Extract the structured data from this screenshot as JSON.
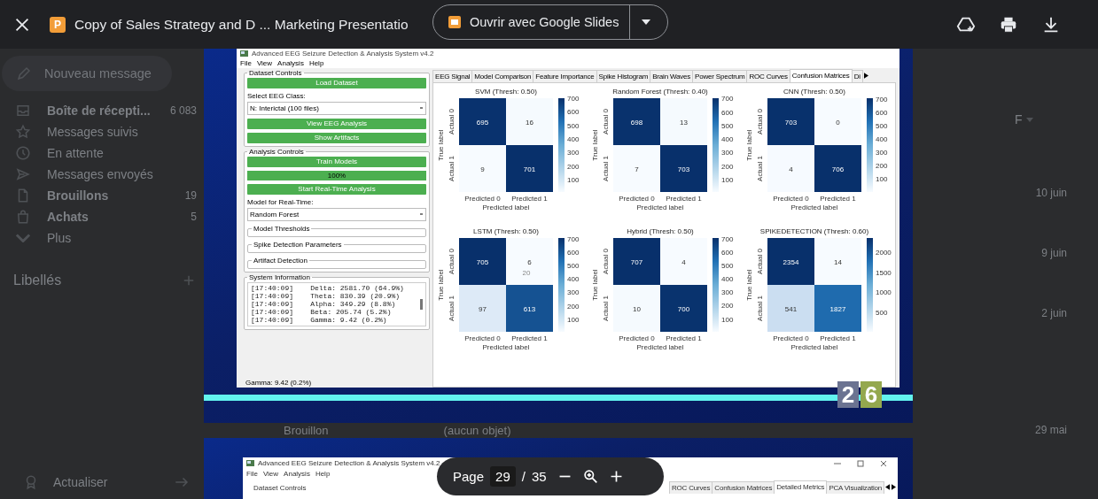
{
  "topbar": {
    "file_badge": "P",
    "title": "Copy of Sales Strategy and D ... Marketing Presentatio",
    "open_button": "Ouvrir avec Google Slides"
  },
  "gmail": {
    "compose": "Nouveau message",
    "nav": [
      {
        "label": "Boîte de récepti...",
        "count": "6 083",
        "unread": true
      },
      {
        "label": "Messages suivis",
        "unread": false
      },
      {
        "label": "En attente",
        "unread": false
      },
      {
        "label": "Messages envoyés",
        "unread": false
      },
      {
        "label": "Brouillons",
        "count": "19",
        "unread": true
      },
      {
        "label": "Achats",
        "count": "5",
        "unread": true
      },
      {
        "label": "Plus",
        "unread": false
      }
    ],
    "labels_heading": "Libellés",
    "upgrade": "Actualiser",
    "list_filter": "F",
    "rows": [
      {
        "kind": "mail",
        "date": "10 juin"
      },
      {
        "kind": "mail",
        "date": "9 juin"
      },
      {
        "kind": "mail",
        "date": "2 juin"
      },
      {
        "kind": "draft",
        "sender": "Brouillon",
        "subject": "(aucun objet)",
        "date": "29 mai"
      }
    ]
  },
  "slides": [
    {
      "window_title": "Advanced EEG Seizure Detection & Analysis System v4.2",
      "menu": [
        "File",
        "View",
        "Analysis",
        "Help"
      ],
      "sections": [
        {
          "title": "Dataset Controls",
          "items": [
            {
              "kind": "button",
              "label": "Load Dataset"
            },
            {
              "kind": "label",
              "label": "Select EEG Class:"
            },
            {
              "kind": "select",
              "value": "N: Interictal (100 files)"
            },
            {
              "kind": "button",
              "label": "View EEG Analysis"
            },
            {
              "kind": "button",
              "label": "Show Artifacts"
            }
          ]
        },
        {
          "title": "Analysis Controls",
          "items": [
            {
              "kind": "button",
              "label": "Train Models"
            },
            {
              "kind": "progress",
              "label": "100%",
              "level": 1
            },
            {
              "kind": "button",
              "label": "Start Real-Time Analysis"
            },
            {
              "kind": "label",
              "label": "Model for Real-Time:"
            },
            {
              "kind": "select",
              "value": "Random Forest"
            },
            {
              "kind": "group",
              "label": "Model Thresholds"
            },
            {
              "kind": "group",
              "label": "Spike Detection Parameters"
            },
            {
              "kind": "group",
              "label": "Artifact Detection"
            }
          ]
        }
      ],
      "system_info": {
        "title": "System Information",
        "lines": [
          "[17:40:09]    Delta: 2581.70 (64.9%)",
          "[17:40:09]    Theta: 830.39 (20.9%)",
          "[17:40:09]    Alpha: 349.29 (8.8%)",
          "[17:40:09]    Beta: 205.74 (5.2%)",
          "[17:40:09]    Gamma: 9.42 (0.2%)"
        ]
      },
      "status": "Gamma: 9.42 (0.2%)",
      "tabs": [
        {
          "label": "EEG Signal",
          "selected": false
        },
        {
          "label": "Model Comparison",
          "selected": false
        },
        {
          "label": "Feature Importance",
          "selected": false
        },
        {
          "label": "Spike Histogram",
          "selected": false
        },
        {
          "label": "Brain Waves",
          "selected": false
        },
        {
          "label": "Power Spectrum",
          "selected": false
        },
        {
          "label": "ROC Curves",
          "selected": false
        },
        {
          "label": "Confusion Matrices",
          "selected": true
        },
        {
          "label": "Di",
          "selected": false
        }
      ],
      "matrices": [
        {
          "title": "SVM (Thresh: 0.50)",
          "cells": [
            [
              "695",
              "16"
            ],
            [
              "9",
              "701"
            ]
          ],
          "colorbar_ticks": [
            "700",
            "600",
            "500",
            "400",
            "300",
            "200",
            "100"
          ],
          "x_ticks": [
            "Predicted 0",
            "Predicted 1"
          ],
          "y_ticks": [
            "Actual 0",
            "Actual 1"
          ],
          "xlabel": "Predicted label",
          "ylabel": "True label"
        },
        {
          "title": "Random Forest (Thresh: 0.40)",
          "cells": [
            [
              "698",
              "13"
            ],
            [
              "7",
              "703"
            ]
          ],
          "colorbar_ticks": [
            "700",
            "600",
            "500",
            "400",
            "300",
            "200",
            "100"
          ],
          "x_ticks": [
            "Predicted 0",
            "Predicted 1"
          ],
          "y_ticks": [
            "Actual 0",
            "Actual 1"
          ],
          "xlabel": "Predicted label",
          "ylabel": "True label"
        },
        {
          "title": "CNN (Thresh: 0.50)",
          "cells": [
            [
              "703",
              "0"
            ],
            [
              "4",
              "706"
            ]
          ],
          "colorbar_ticks": [
            "700",
            "600",
            "500",
            "400",
            "300",
            "200",
            "100"
          ],
          "x_ticks": [
            "Predicted 0",
            "Predicted 1"
          ],
          "y_ticks": [
            "Actual 0",
            "Actual 1"
          ],
          "xlabel": "Predicted label",
          "ylabel": "True label"
        },
        {
          "title": "LSTM (Thresh: 0.50)",
          "cells": [
            [
              "705",
              "6"
            ],
            [
              "97",
              "613"
            ]
          ],
          "annotation": "20",
          "colorbar_ticks": [
            "700",
            "600",
            "500",
            "400",
            "300",
            "200",
            "100"
          ],
          "x_ticks": [
            "Predicted 0",
            "Predicted 1"
          ],
          "y_ticks": [
            "Actual 0",
            "Actual 1"
          ],
          "xlabel": "Predicted label",
          "ylabel": "True label"
        },
        {
          "title": "Hybrid (Thresh: 0.50)",
          "cells": [
            [
              "707",
              "4"
            ],
            [
              "10",
              "700"
            ]
          ],
          "colorbar_ticks": [
            "700",
            "600",
            "500",
            "400",
            "300",
            "200",
            "100"
          ],
          "x_ticks": [
            "Predicted 0",
            "Predicted 1"
          ],
          "y_ticks": [
            "Actual 0",
            "Actual 1"
          ],
          "xlabel": "Predicted label",
          "ylabel": "True label"
        },
        {
          "title": "SPIKEDETECTION (Thresh: 0.60)",
          "cells": [
            [
              "2354",
              "14"
            ],
            [
              "541",
              "1827"
            ]
          ],
          "colorbar_ticks": [
            "2000",
            "1500",
            "1000",
            "500"
          ],
          "x_ticks": [
            "Predicted 0",
            "Predicted 1"
          ],
          "y_ticks": [
            "Actual 0",
            "Actual 1"
          ],
          "xlabel": "Predicted label",
          "ylabel": "True label"
        }
      ],
      "logo_digits": [
        "2",
        "6"
      ]
    },
    {
      "window_title": "Advanced EEG Seizure Detection & Analysis System v4.2",
      "menu": [
        "File",
        "View",
        "Analysis",
        "Help"
      ],
      "first_section": "Dataset Controls",
      "tabs": [
        {
          "label": "ROC Curves",
          "selected": false
        },
        {
          "label": "Confusion Matrices",
          "selected": false
        },
        {
          "label": "Detailed Metrics",
          "selected": true
        },
        {
          "label": "PCA Visualization",
          "selected": false
        }
      ]
    }
  ],
  "pager": {
    "label": "Page",
    "current": "29",
    "separator": "/",
    "total": "35"
  }
}
